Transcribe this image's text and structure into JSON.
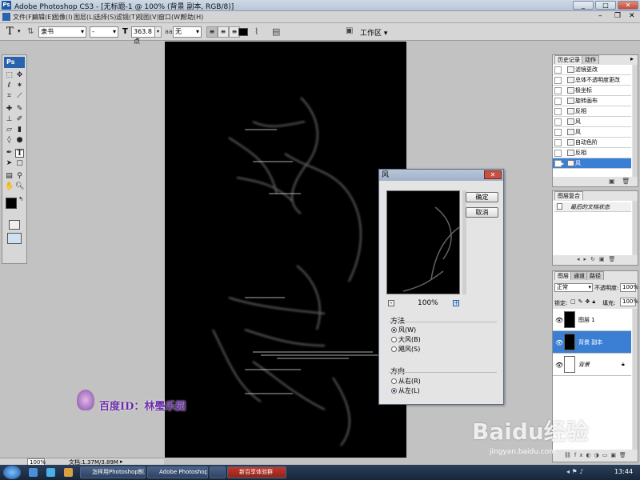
{
  "window": {
    "logo": "Ps",
    "title": "Adobe Photoshop CS3 - [无标题-1 @ 100% (背景 副本, RGB/8)]",
    "controls": [
      "_",
      "□",
      "✕"
    ]
  },
  "menu": [
    "文件(F)",
    "编辑(E)",
    "图像(I)",
    "图层(L)",
    "选择(S)",
    "滤镜(T)",
    "视图(V)",
    "窗口(W)",
    "帮助(H)"
  ],
  "options": {
    "font_family": "隶书",
    "font_style": "-",
    "font_size": "363.8 点",
    "antialias": "无",
    "workspace": "工作区"
  },
  "toolbox": {
    "logo": "Ps"
  },
  "dialog": {
    "title": "风",
    "ok": "确定",
    "cancel": "取消",
    "zoom": "100%",
    "method_label": "方法",
    "methods": [
      "风(W)",
      "大风(B)",
      "飓风(S)"
    ],
    "method_selected": 0,
    "direction_label": "方向",
    "directions": [
      "从右(R)",
      "从左(L)"
    ],
    "direction_selected": 1
  },
  "history_panel": {
    "tabs": [
      "历史记录",
      "动作"
    ],
    "items": [
      "滤镜更改",
      "总体不透明度更改",
      "极坐标",
      "旋转画布",
      "反相",
      "风",
      "风",
      "自动色阶",
      "反相",
      "风"
    ],
    "selected": 9
  },
  "layer_comps_panel": {
    "tab": "图层复合",
    "text": "最后的文档状态"
  },
  "layers_panel": {
    "tabs": [
      "图层",
      "通道",
      "路径"
    ],
    "blend_mode": "正常",
    "opacity_label": "不透明度:",
    "opacity": "100%",
    "lock_label": "锁定:",
    "fill_label": "填充:",
    "fill": "100%",
    "layers": [
      "图层 1",
      "背景 副本",
      "背景"
    ],
    "selected": 1
  },
  "statusbar": {
    "zoom": "100%",
    "doc": "文档:1.37M/3.89M"
  },
  "watermark": {
    "text": "百度ID：林璺乐园"
  },
  "baidu": {
    "logo": "Baidu经验",
    "url": "jingyan.baidu.com"
  },
  "taskbar": {
    "tasks": [
      "怎样用Photoshop制...",
      "Adobe Photoshop ...",
      "",
      "新百享体验群"
    ],
    "clock": "13:44"
  }
}
